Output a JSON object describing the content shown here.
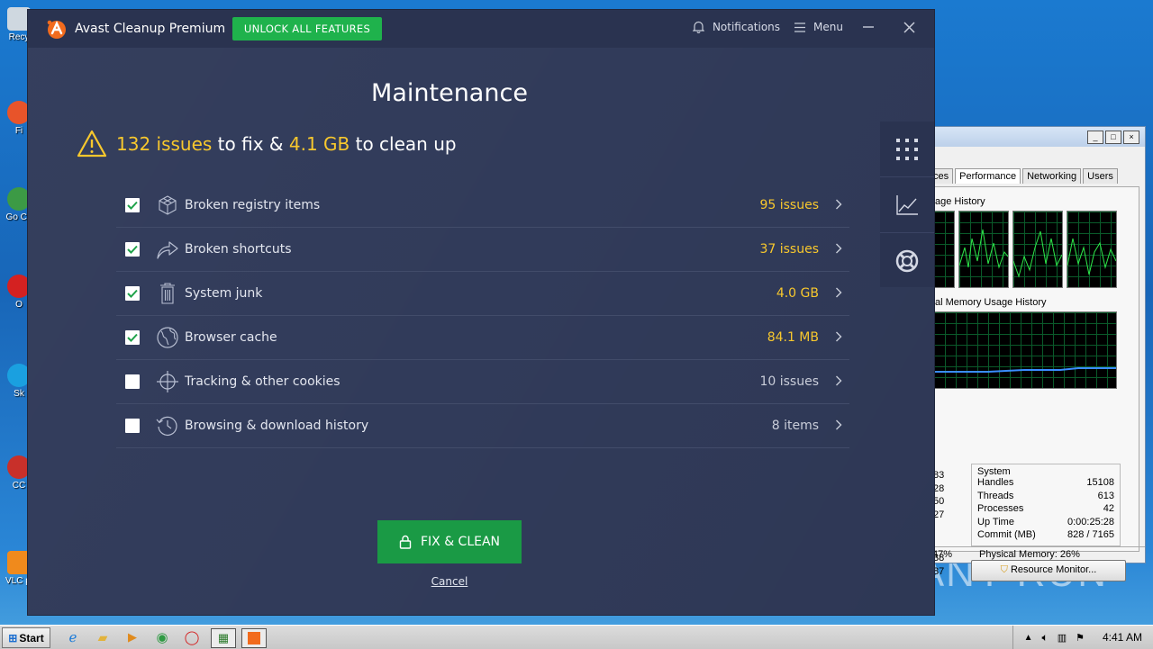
{
  "avast": {
    "app_name": "Avast Cleanup Premium",
    "unlock_label": "UNLOCK ALL FEATURES",
    "notifications_label": "Notifications",
    "menu_label": "Menu",
    "title": "Maintenance",
    "summary": {
      "issues": "132 issues",
      "to_fix": " to fix & ",
      "size": "4.1 GB",
      "to_clean": " to clean up"
    },
    "items": [
      {
        "label": "Broken registry items",
        "value": "95 issues",
        "checked": true,
        "icon": "registry-cube-icon"
      },
      {
        "label": "Broken shortcuts",
        "value": "37 issues",
        "checked": true,
        "icon": "shortcut-arrow-icon"
      },
      {
        "label": "System junk",
        "value": "4.0 GB",
        "checked": true,
        "icon": "trash-icon"
      },
      {
        "label": "Browser cache",
        "value": "84.1 MB",
        "checked": true,
        "icon": "globe-icon"
      },
      {
        "label": "Tracking & other cookies",
        "value": "10 issues",
        "checked": false,
        "icon": "crosshair-icon"
      },
      {
        "label": "Browsing & download history",
        "value": "8 items",
        "checked": false,
        "icon": "history-clock-icon"
      }
    ],
    "fix_label": "FIX & CLEAN",
    "cancel_label": "Cancel",
    "colors": {
      "accent": "#f8c82d",
      "green": "#1fb24c",
      "bg": "#313b5a"
    }
  },
  "taskmgr": {
    "tabs": [
      "ces",
      "Performance",
      "Networking",
      "Users"
    ],
    "cpu_history_label": "age History",
    "memory_history_label": "al Memory Usage History",
    "left_values": [
      "83",
      "28",
      "50",
      "27"
    ],
    "left_values2": [
      "38",
      "87"
    ],
    "system": {
      "title": "System",
      "rows": [
        {
          "k": "Handles",
          "v": "15108"
        },
        {
          "k": "Threads",
          "v": "613"
        },
        {
          "k": "Processes",
          "v": "42"
        },
        {
          "k": "Up Time",
          "v": "0:00:25:28"
        },
        {
          "k": "Commit (MB)",
          "v": "828 / 7165"
        }
      ]
    },
    "resource_monitor_label": "Resource Monitor...",
    "status_cpu": "47%",
    "status_memory": "Physical Memory: 26%"
  },
  "desktop": {
    "icons": [
      "Recy",
      "Fi",
      "Go Ch",
      "O",
      "Sk",
      "CC",
      "VLC pl"
    ]
  },
  "watermark": "ANY RUN",
  "taskbar": {
    "start_label": "Start",
    "clock": "4:41 AM"
  }
}
